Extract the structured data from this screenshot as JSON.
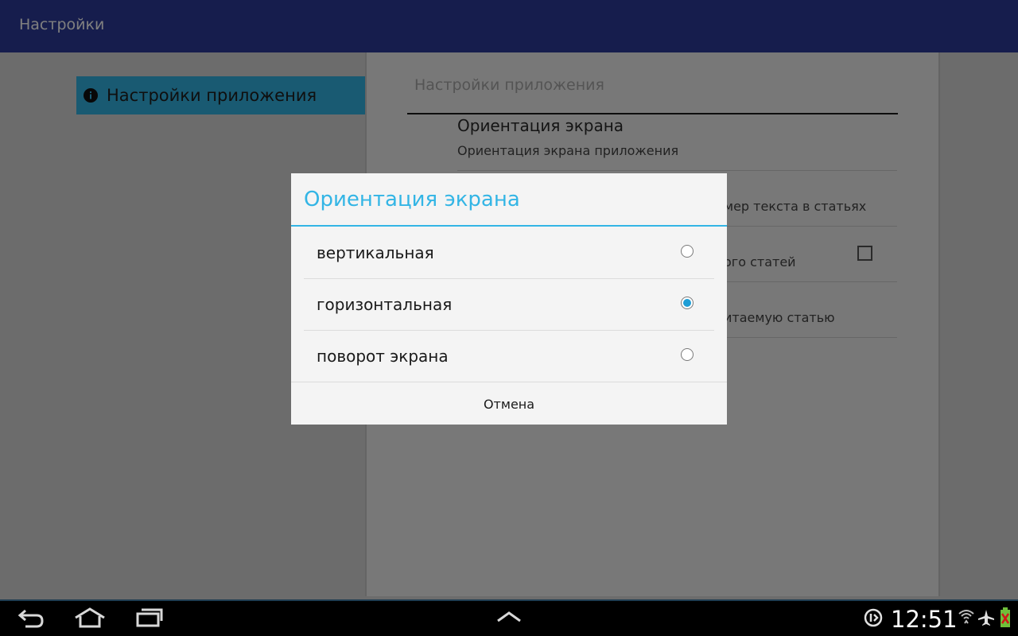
{
  "actionbar": {
    "title": "Настройки"
  },
  "headers": [
    {
      "label": "Настройки приложения",
      "icon": "info-icon",
      "selected": true
    }
  ],
  "prefs": {
    "category": "Настройки приложения",
    "items": [
      {
        "title": "Ориентация экрана",
        "summary": "Ориентация экрана приложения"
      },
      {
        "title": "",
        "summary": "мер текста в статьях"
      },
      {
        "title": "",
        "summary": "ого статей",
        "checkbox": false
      },
      {
        "title": "",
        "summary": "итаемую статью"
      }
    ]
  },
  "dialog": {
    "title": "Ориентация экрана",
    "options": [
      {
        "label": "вертикальная",
        "checked": false
      },
      {
        "label": "горизонтальная",
        "checked": true
      },
      {
        "label": "поворот экрана",
        "checked": false
      }
    ],
    "cancel_label": "Отмена"
  },
  "system_bar": {
    "time": "12:51",
    "nav_icons": [
      "back-icon",
      "home-icon",
      "recent-apps-icon",
      "chevron-up-icon"
    ],
    "status_icons": [
      "sync-off-icon",
      "wifi-icon",
      "airplane-icon",
      "battery-icon"
    ]
  },
  "colors": {
    "accent": "#33b5e5",
    "actionbar": "#2d3a9a",
    "radio_checked": "#1e9ed6"
  }
}
